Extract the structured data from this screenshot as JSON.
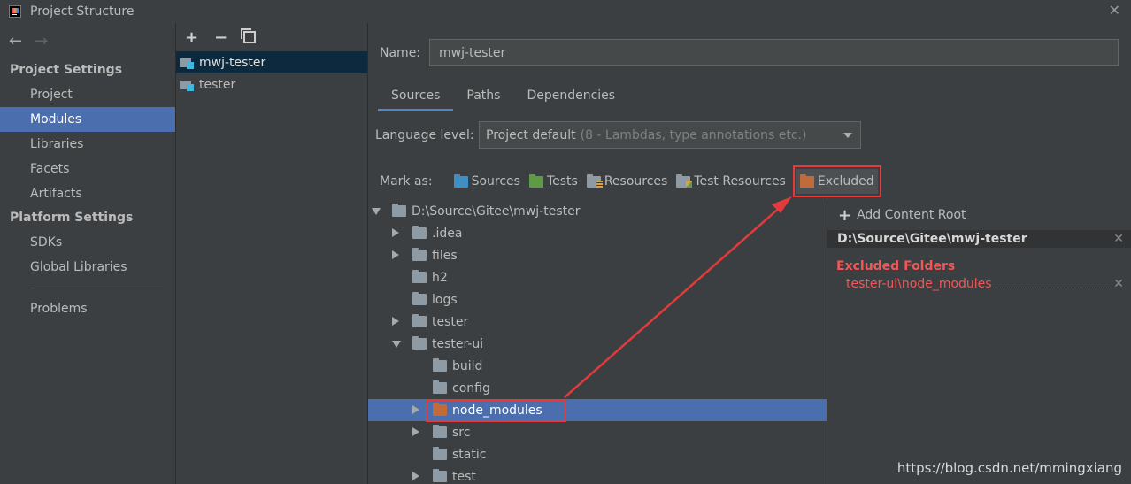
{
  "window": {
    "title": "Project Structure",
    "close_glyph": "✕"
  },
  "nav": {
    "back": "←",
    "forward": "→",
    "project_settings": "Project Settings",
    "project_items": [
      "Project",
      "Modules",
      "Libraries",
      "Facets",
      "Artifacts"
    ],
    "platform_settings": "Platform Settings",
    "platform_items": [
      "SDKs",
      "Global Libraries"
    ],
    "problems": "Problems",
    "selected": "Modules"
  },
  "modules": {
    "toolbar": {
      "add": "+",
      "remove": "−"
    },
    "items": [
      "mwj-tester",
      "tester"
    ]
  },
  "main": {
    "name_label": "Name:",
    "name_value": "mwj-tester",
    "tabs": [
      "Sources",
      "Paths",
      "Dependencies"
    ],
    "active_tab": "Sources",
    "language_label": "Language level:",
    "language_value": "Project default",
    "language_hint": "(8 - Lambdas, type annotations etc.)",
    "mark_as_label": "Mark as:",
    "mark_buttons": [
      "Sources",
      "Tests",
      "Resources",
      "Test Resources",
      "Excluded"
    ]
  },
  "tree": {
    "root": "D:\\Source\\Gitee\\mwj-tester",
    "level1": [
      ".idea",
      "files",
      "h2",
      "logs",
      "tester",
      "tester-ui"
    ],
    "level2": [
      "build",
      "config",
      "node_modules",
      "src",
      "static",
      "test"
    ]
  },
  "content_root": {
    "add_label": "Add Content Root",
    "path": "D:\\Source\\Gitee\\mwj-tester",
    "excluded_heading": "Excluded Folders",
    "excluded_items": [
      "tester-ui\\node_modules"
    ]
  },
  "watermark": "https://blog.csdn.net/mmingxiang",
  "colors": {
    "selection": "#4b6eaf",
    "highlight": "#e33b3b",
    "excluded": "#f25757",
    "accent": "#4a88c7"
  },
  "icons": [
    "back-arrow-icon",
    "forward-arrow-icon",
    "add-icon",
    "remove-icon",
    "copy-icon",
    "module-icon",
    "folder-icon",
    "excluded-folder-icon",
    "chevron-down-icon",
    "close-icon"
  ]
}
